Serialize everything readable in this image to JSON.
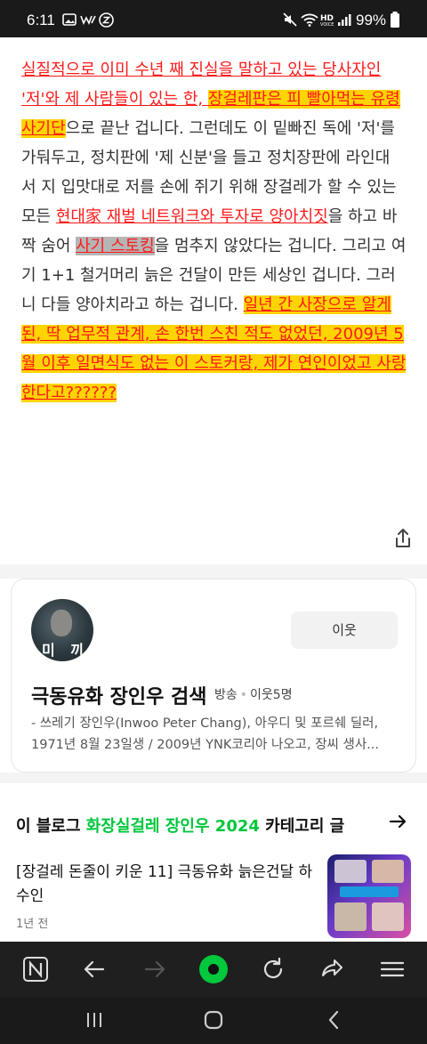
{
  "status_bar": {
    "time": "6:11",
    "battery": "99%",
    "icons": [
      "gallery-icon",
      "w-app-icon",
      "z-app-icon",
      "mute-icon",
      "wifi-icon",
      "hd-voice-icon",
      "signal-icon",
      "battery-icon"
    ]
  },
  "article": {
    "lines": [
      [
        {
          "t": "실질적으로 이미 수년 째 진실을 말하고 있는 당사자인",
          "s": "red"
        }
      ],
      [
        {
          "t": "'저'와 제 사람들이 있는 한, ",
          "s": "red"
        },
        {
          "t": "장걸레판은 피 빨아먹는 유령",
          "s": "red hl"
        }
      ],
      [
        {
          "t": "사기단",
          "s": "red hl"
        },
        {
          "t": "으로 끝난 겁니다. 그런데도 이 밑빠진 독에 '저'를",
          "s": ""
        }
      ],
      [
        {
          "t": "가둬두고, 정치판에 '제 신분'을 들고 정치장판에 라인대",
          "s": ""
        }
      ],
      [
        {
          "t": "서 지 입맛대로 저를 손에 쥐기 위해 장걸레가 할 수 있는",
          "s": ""
        }
      ],
      [
        {
          "t": "모든 ",
          "s": ""
        },
        {
          "t": "현대家 재벌 네트워크와 투자로 양아치짓",
          "s": "red"
        },
        {
          "t": "을 하고 바",
          "s": ""
        }
      ],
      [
        {
          "t": "짝 숨어 ",
          "s": ""
        },
        {
          "t": "사기 스토킹",
          "s": "red gr"
        },
        {
          "t": "을 멈추지 않았다는 겁니다. 그리고 여",
          "s": ""
        }
      ],
      [
        {
          "t": "기 1+1 철거머리 늙은 건달이 만든 세상인 겁니다. 그러",
          "s": ""
        }
      ],
      [
        {
          "t": "니 다들 양아치라고 하는 겁니다. ",
          "s": ""
        },
        {
          "t": "일년 간 사장으로 알게",
          "s": "red hl"
        }
      ],
      [
        {
          "t": "된, 딱 업무적 관계, 손 한번 스친 적도 없었던, 2009년 5",
          "s": "red hl"
        }
      ],
      [
        {
          "t": "월 이후 일면식도 없는 이 스토커랑, 제가 연인이었고 사랑",
          "s": "red hl"
        }
      ],
      [
        {
          "t": "한다고??????",
          "s": "red hl"
        }
      ]
    ]
  },
  "blogger_card": {
    "avatar_text": "미 끼",
    "neighbor_button": "이웃",
    "blog_name": "극동유화 장인우 검색",
    "category": "방송",
    "neighbors": "이웃5명",
    "description": "- 쓰레기 장인우(Inwoo Peter Chang), 아우디 및 포르쉐 딜러, 1971년 8월 23일생 / 2009년 YNK코리아 나오고, 장씨 생사..."
  },
  "category_section": {
    "prefix": "이 블로그 ",
    "category_name": "화장실걸레 장인우 2024",
    "suffix": " 카테고리 글",
    "post": {
      "title": "[장걸레 돈줄이 키운 11] 극동유화 늙은건달 하수인",
      "time": "1년 전"
    }
  },
  "colors": {
    "accent_green": "#00c73c",
    "red_text": "#ff1a1a",
    "highlight_yellow": "#ffd400",
    "highlight_gray": "#b5b5b5"
  },
  "toolbar_icons": [
    "naver-n-icon",
    "back-arrow-icon",
    "forward-arrow-icon",
    "green-home-icon",
    "refresh-icon",
    "share-icon",
    "menu-icon"
  ],
  "system_nav": [
    "recent-apps-icon",
    "home-icon",
    "back-icon"
  ]
}
